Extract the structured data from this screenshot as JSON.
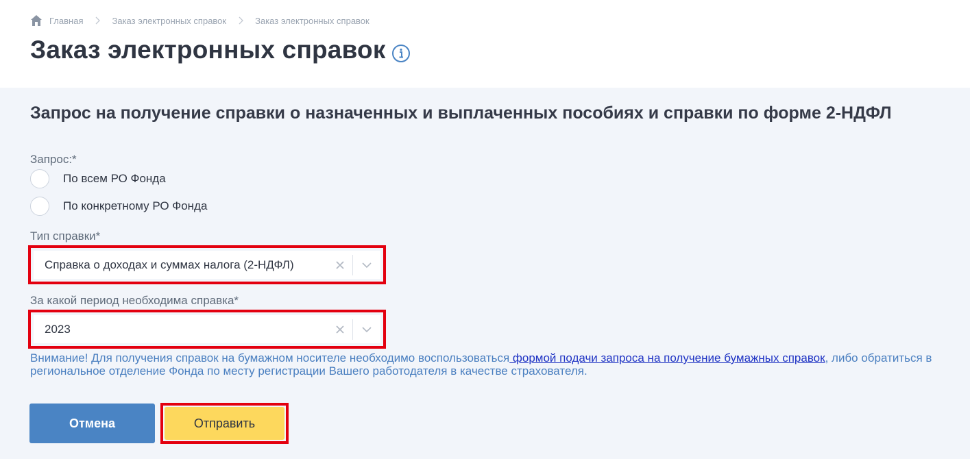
{
  "breadcrumb": {
    "home": "Главная",
    "level2": "Заказ электронных справок",
    "level3": "Заказ электронных справок"
  },
  "page": {
    "title": "Заказ электронных справок"
  },
  "form": {
    "title": "Запрос на получение справки о назначенных и выплаченных пособиях и справки по форме 2-НДФЛ",
    "request_label": "Запрос:*",
    "request_options": [
      "По всем РО Фонда",
      "По конкретному РО Фонда"
    ],
    "cert_type_label": "Тип справки*",
    "cert_type_value": "Справка о доходах и суммах налога (2-НДФЛ)",
    "period_label": "За какой период необходима справка*",
    "period_value": "2023",
    "notice_prefix": "Внимание! Для получения справок на бумажном носителе необходимо воспользоваться",
    "notice_link": " формой подачи запроса на получение бумажных справок",
    "notice_suffix": ", либо обратиться в региональное отделение Фонда по месту регистрации Вашего работодателя в качестве страхователя.",
    "cancel_label": "Отмена",
    "submit_label": "Отправить"
  },
  "icons": {
    "home": "home-icon",
    "separator": "chevron-right-icon",
    "info": "info-icon",
    "clear": "close-icon",
    "dropdown": "chevron-down-icon"
  },
  "colors": {
    "title": "#2f3542",
    "panel_bg": "#f2f5fa",
    "cancel_button": "#4a84c4",
    "submit_button": "#fdd85d",
    "highlight_border": "#e3000f",
    "notice_text": "#4a7fc0",
    "link": "#1f33c4"
  }
}
